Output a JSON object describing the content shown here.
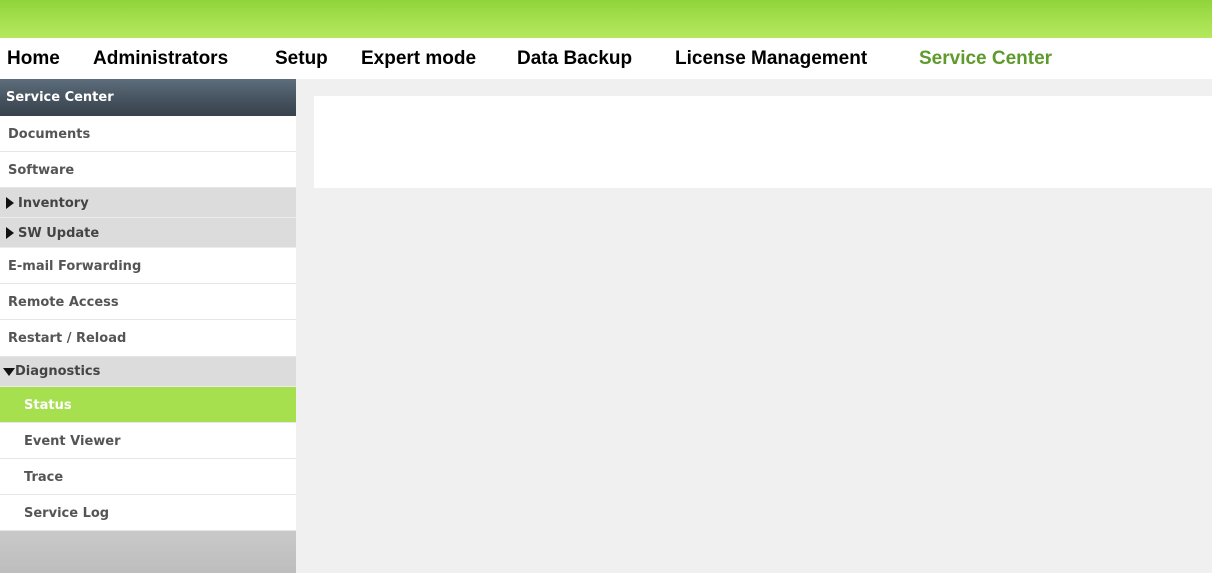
{
  "nav": {
    "items": [
      {
        "label": "Home"
      },
      {
        "label": "Administrators"
      },
      {
        "label": "Setup"
      },
      {
        "label": "Expert mode"
      },
      {
        "label": "Data Backup"
      },
      {
        "label": "License Management"
      },
      {
        "label": "Service Center",
        "active": true
      }
    ]
  },
  "sidebar": {
    "header": "Service Center",
    "items": [
      {
        "label": "Documents"
      },
      {
        "label": "Software"
      },
      {
        "label": "Inventory",
        "group": true,
        "expanded": false
      },
      {
        "label": "SW Update",
        "group": true,
        "expanded": false
      },
      {
        "label": "E-mail Forwarding"
      },
      {
        "label": "Remote Access"
      },
      {
        "label": "Restart / Reload"
      },
      {
        "label": "Diagnostics",
        "group": true,
        "expanded": true
      },
      {
        "label": "Status",
        "selected": true
      },
      {
        "label": "Event Viewer"
      },
      {
        "label": "Trace"
      },
      {
        "label": "Service Log"
      }
    ]
  },
  "colors": {
    "accent_green": "#a6e04f",
    "active_nav_text": "#5f9a2c",
    "sidebar_header": "#46535f"
  }
}
